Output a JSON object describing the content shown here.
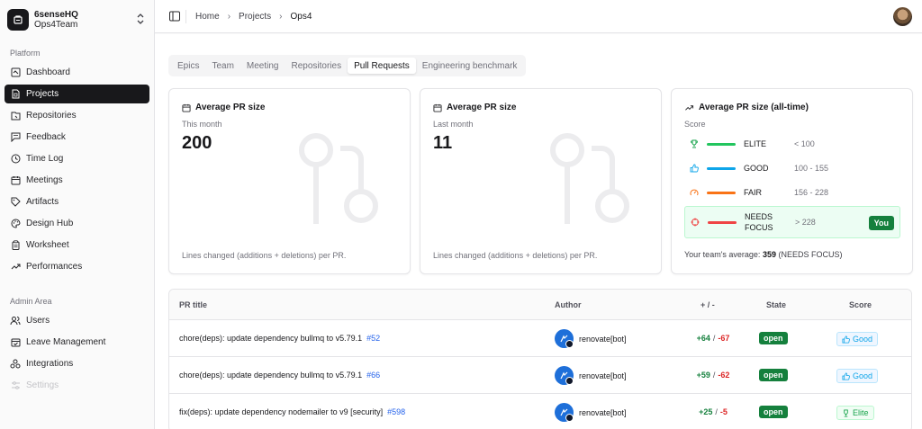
{
  "team": {
    "name": "6senseHQ",
    "sub": "Ops4Team"
  },
  "sidebar": {
    "platform_label": "Platform",
    "items": [
      {
        "label": "Dashboard",
        "icon": "dashboard-icon"
      },
      {
        "label": "Projects",
        "icon": "projects-icon",
        "active": true
      },
      {
        "label": "Repositories",
        "icon": "repositories-icon"
      },
      {
        "label": "Feedback",
        "icon": "feedback-icon"
      },
      {
        "label": "Time Log",
        "icon": "clock-icon"
      },
      {
        "label": "Meetings",
        "icon": "calendar-icon"
      },
      {
        "label": "Artifacts",
        "icon": "tag-icon"
      },
      {
        "label": "Design Hub",
        "icon": "palette-icon"
      },
      {
        "label": "Worksheet",
        "icon": "clipboard-icon"
      },
      {
        "label": "Performances",
        "icon": "trend-icon"
      }
    ],
    "admin_label": "Admin Area",
    "admin_items": [
      {
        "label": "Users",
        "icon": "users-icon"
      },
      {
        "label": "Leave Management",
        "icon": "calendar-check-icon"
      },
      {
        "label": "Integrations",
        "icon": "integrations-icon"
      },
      {
        "label": "Settings",
        "icon": "settings-icon",
        "disabled": true
      }
    ]
  },
  "breadcrumb": {
    "home": "Home",
    "projects": "Projects",
    "current": "Ops4"
  },
  "tabs": [
    "Epics",
    "Team",
    "Meeting",
    "Repositories",
    "Pull Requests",
    "Engineering benchmark"
  ],
  "active_tab": "Pull Requests",
  "cards": [
    {
      "title": "Average PR size",
      "sub": "This month",
      "value": "200",
      "foot": "Lines changed (additions + deletions) per PR."
    },
    {
      "title": "Average PR size",
      "sub": "Last month",
      "value": "11",
      "foot": "Lines changed (additions + deletions) per PR."
    }
  ],
  "score_card": {
    "title": "Average PR size (all-time)",
    "sub": "Score",
    "rows": [
      {
        "label": "ELITE",
        "range": "< 100",
        "color": "#22c55e",
        "icon": "trophy-icon"
      },
      {
        "label": "GOOD",
        "range": "100 - 155",
        "color": "#0ea5e9",
        "icon": "thumbs-up-icon"
      },
      {
        "label": "FAIR",
        "range": "156 - 228",
        "color": "#f97316",
        "icon": "gauge-icon"
      },
      {
        "label": "NEEDS FOCUS",
        "range": "> 228",
        "color": "#ef4444",
        "icon": "crosshair-icon"
      }
    ],
    "you_label": "You",
    "avg_prefix": "Your team's average:",
    "avg_value": "359",
    "avg_suffix": "(NEEDS FOCUS)"
  },
  "table": {
    "headers": {
      "title": "PR title",
      "author": "Author",
      "diff": "+ / -",
      "state": "State",
      "score": "Score"
    },
    "rows": [
      {
        "title": "chore(deps): update dependency bullmq to v5.79.1",
        "number": "#52",
        "author": "renovate[bot]",
        "plus": "+64",
        "minus": "-67",
        "state": "open",
        "score": "Good"
      },
      {
        "title": "chore(deps): update dependency bullmq to v5.79.1",
        "number": "#66",
        "author": "renovate[bot]",
        "plus": "+59",
        "minus": "-62",
        "state": "open",
        "score": "Good"
      },
      {
        "title": "fix(deps): update dependency nodemailer to v9 [security]",
        "number": "#598",
        "author": "renovate[bot]",
        "plus": "+25",
        "minus": "-5",
        "state": "open",
        "score": "Elite"
      }
    ]
  }
}
